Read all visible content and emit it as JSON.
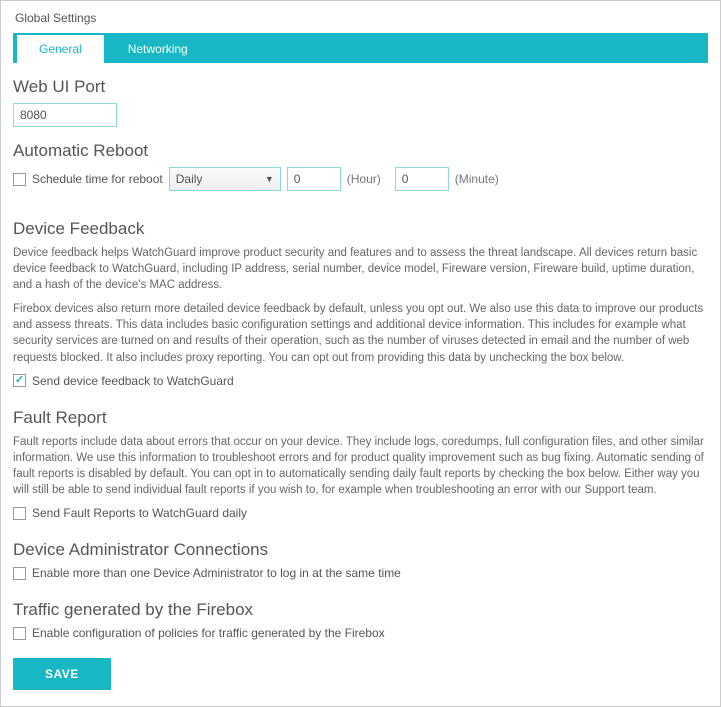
{
  "panel_title": "Global Settings",
  "tabs": {
    "general": "General",
    "networking": "Networking"
  },
  "webuiport": {
    "heading": "Web UI Port",
    "value": "8080"
  },
  "autoreboot": {
    "heading": "Automatic Reboot",
    "checkbox_label": "Schedule time for reboot",
    "frequency": "Daily",
    "hour_value": "0",
    "hour_label": "(Hour)",
    "minute_value": "0",
    "minute_label": "(Minute)"
  },
  "feedback": {
    "heading": "Device Feedback",
    "para1": "Device feedback helps WatchGuard improve product security and features and to assess the threat landscape. All devices return basic device feedback to WatchGuard, including IP address, serial number, device model, Fireware version, Fireware build, uptime duration, and a hash of the device's MAC address.",
    "para2": "Firebox devices also return more detailed device feedback by default, unless you opt out. We also use this data to improve our products and assess threats. This data includes basic configuration settings and additional device information. This includes for example what security services are turned on and results of their operation, such as the number of viruses detected in email and the number of web requests blocked. It also includes proxy reporting. You can opt out from providing this data by unchecking the box below.",
    "checkbox_label": "Send device feedback to WatchGuard"
  },
  "fault": {
    "heading": "Fault Report",
    "para": "Fault reports include data about errors that occur on your device. They include logs, coredumps, full configuration files, and other similar information. We use this information to troubleshoot errors and for product quality improvement such as bug fixing. Automatic sending of fault reports is disabled by default. You can opt in to automatically sending daily fault reports by checking the box below. Either way you will still be able to send individual fault reports if you wish to, for example when troubleshooting an error with our Support team.",
    "checkbox_label": "Send Fault Reports to WatchGuard daily"
  },
  "admin": {
    "heading": "Device Administrator Connections",
    "checkbox_label": "Enable more than one Device Administrator to log in at the same time"
  },
  "traffic": {
    "heading": "Traffic generated by the Firebox",
    "checkbox_label": "Enable configuration of policies for traffic generated by the Firebox"
  },
  "save_label": "SAVE"
}
